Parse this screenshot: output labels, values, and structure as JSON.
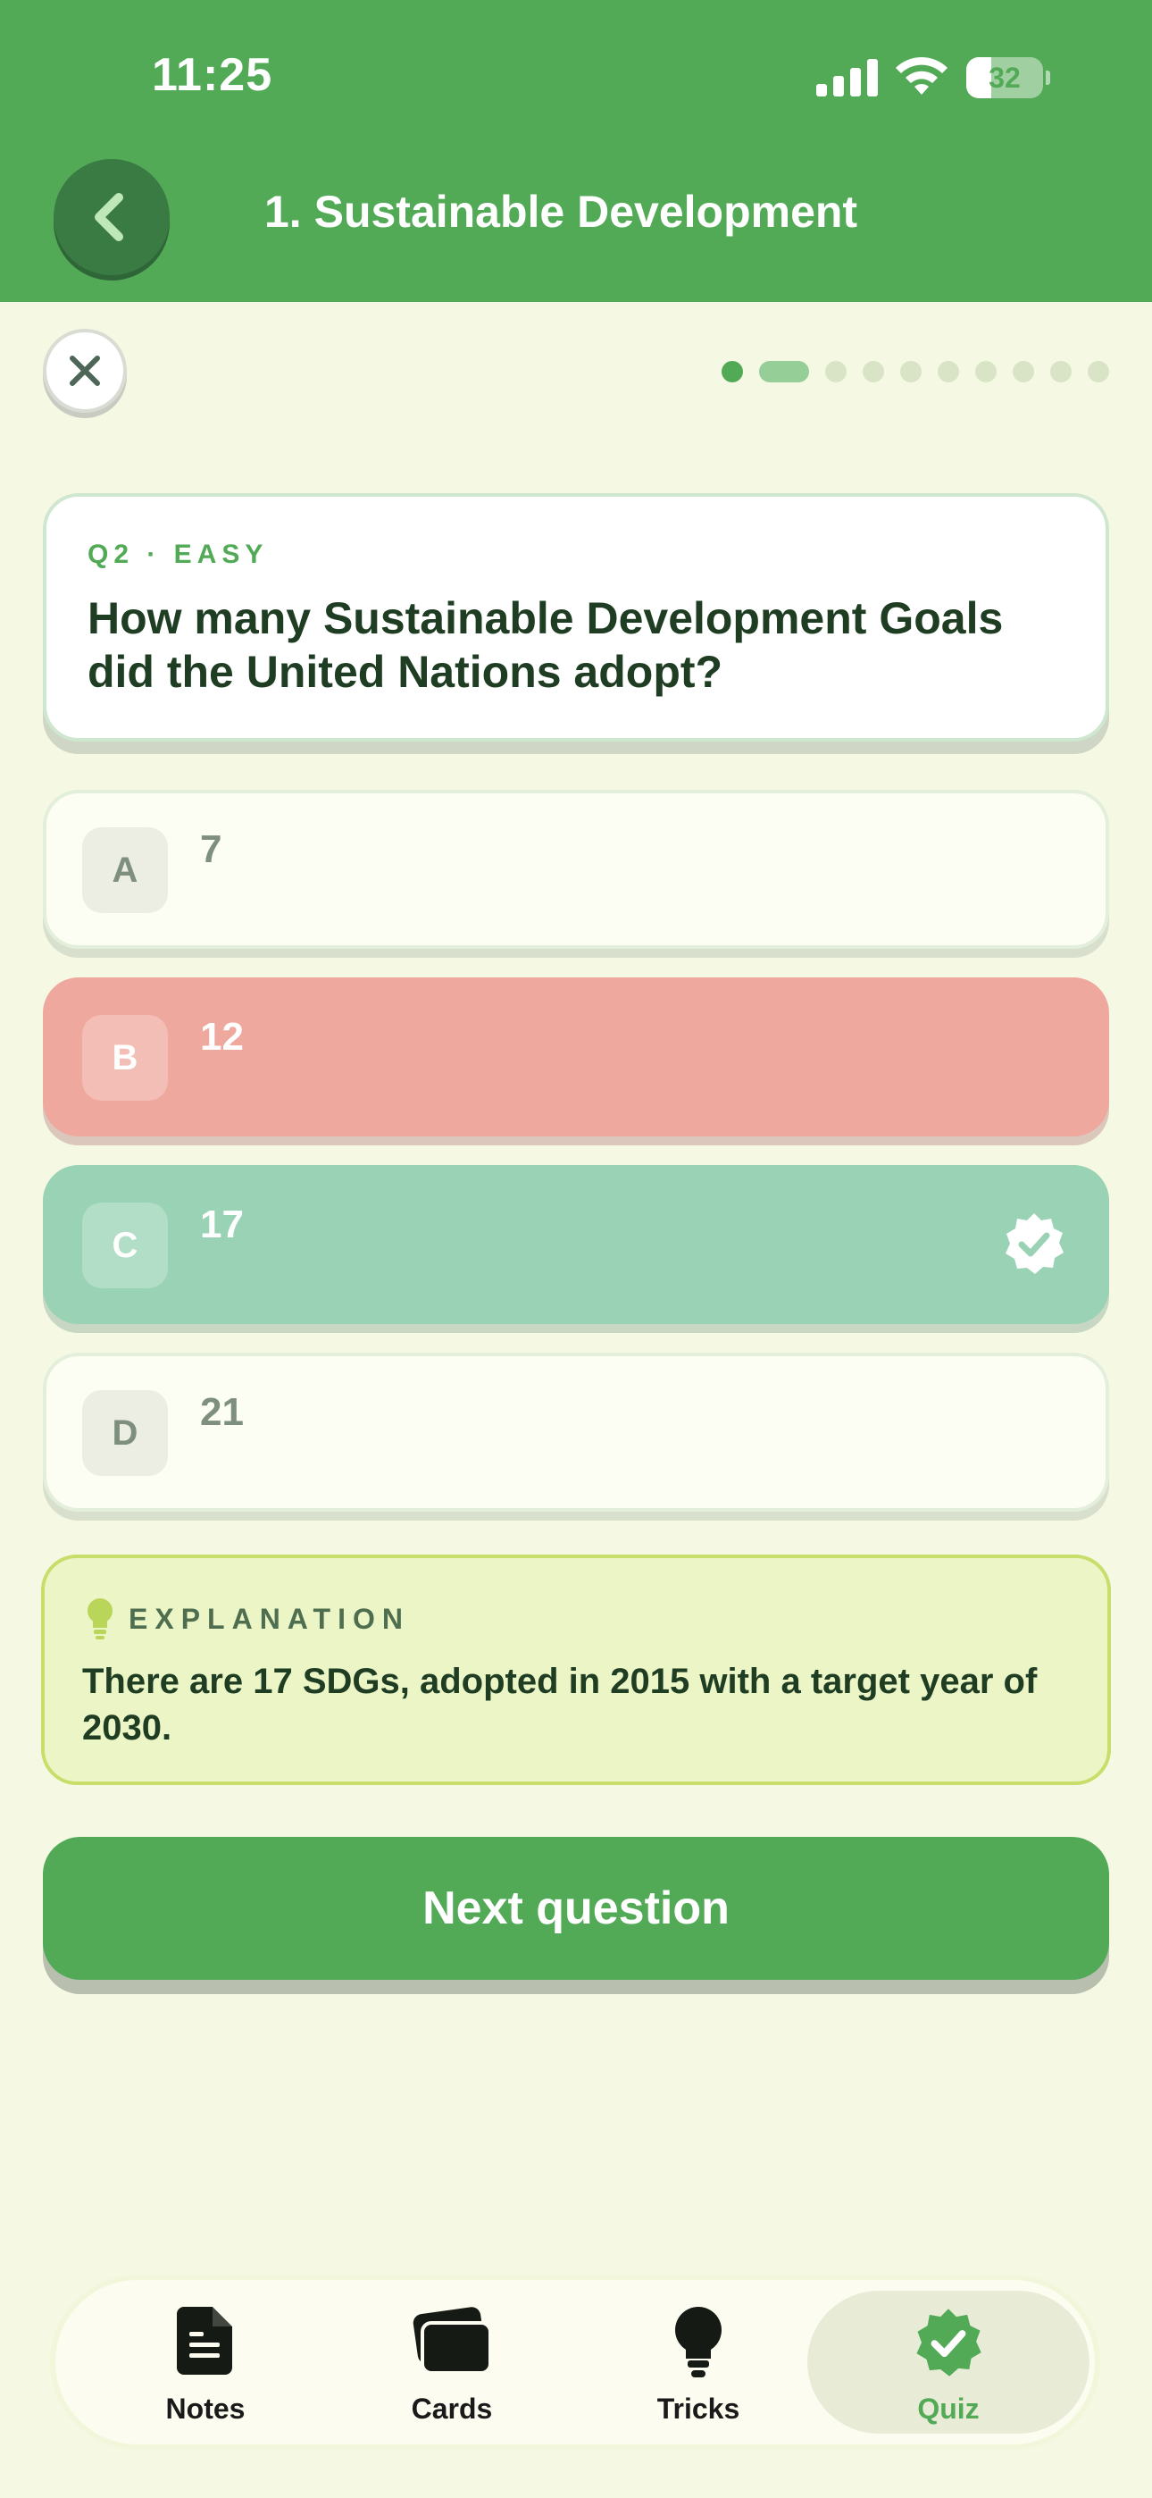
{
  "status_bar": {
    "time": "11:25",
    "battery": "32",
    "battery_level": 0.32
  },
  "header": {
    "title": "1. Sustainable Development"
  },
  "progress": {
    "total": 10,
    "current": 2
  },
  "question": {
    "meta": "Q2 · EASY",
    "text": "How many Sustainable Development Goals did the United Nations adopt?"
  },
  "options": [
    {
      "letter": "A",
      "text": "7",
      "state": "default"
    },
    {
      "letter": "B",
      "text": "12",
      "state": "wrong"
    },
    {
      "letter": "C",
      "text": "17",
      "state": "correct"
    },
    {
      "letter": "D",
      "text": "21",
      "state": "default"
    }
  ],
  "explanation": {
    "heading": "EXPLANATION",
    "text": "There are 17 SDGs, adopted in 2015 with a target year of 2030."
  },
  "next_button": {
    "label": "Next question"
  },
  "tabs": [
    {
      "label": "Notes",
      "icon": "notes-icon"
    },
    {
      "label": "Cards",
      "icon": "cards-icon"
    },
    {
      "label": "Tricks",
      "icon": "bulb-icon"
    },
    {
      "label": "Quiz",
      "icon": "quiz-badge-icon",
      "active": true
    }
  ],
  "colors": {
    "primary_green": "#52aa57",
    "background": "#f5f9e4",
    "wrong": "#efa89d",
    "correct": "#99d2b4",
    "explanation_bg": "#ebf5c6"
  }
}
